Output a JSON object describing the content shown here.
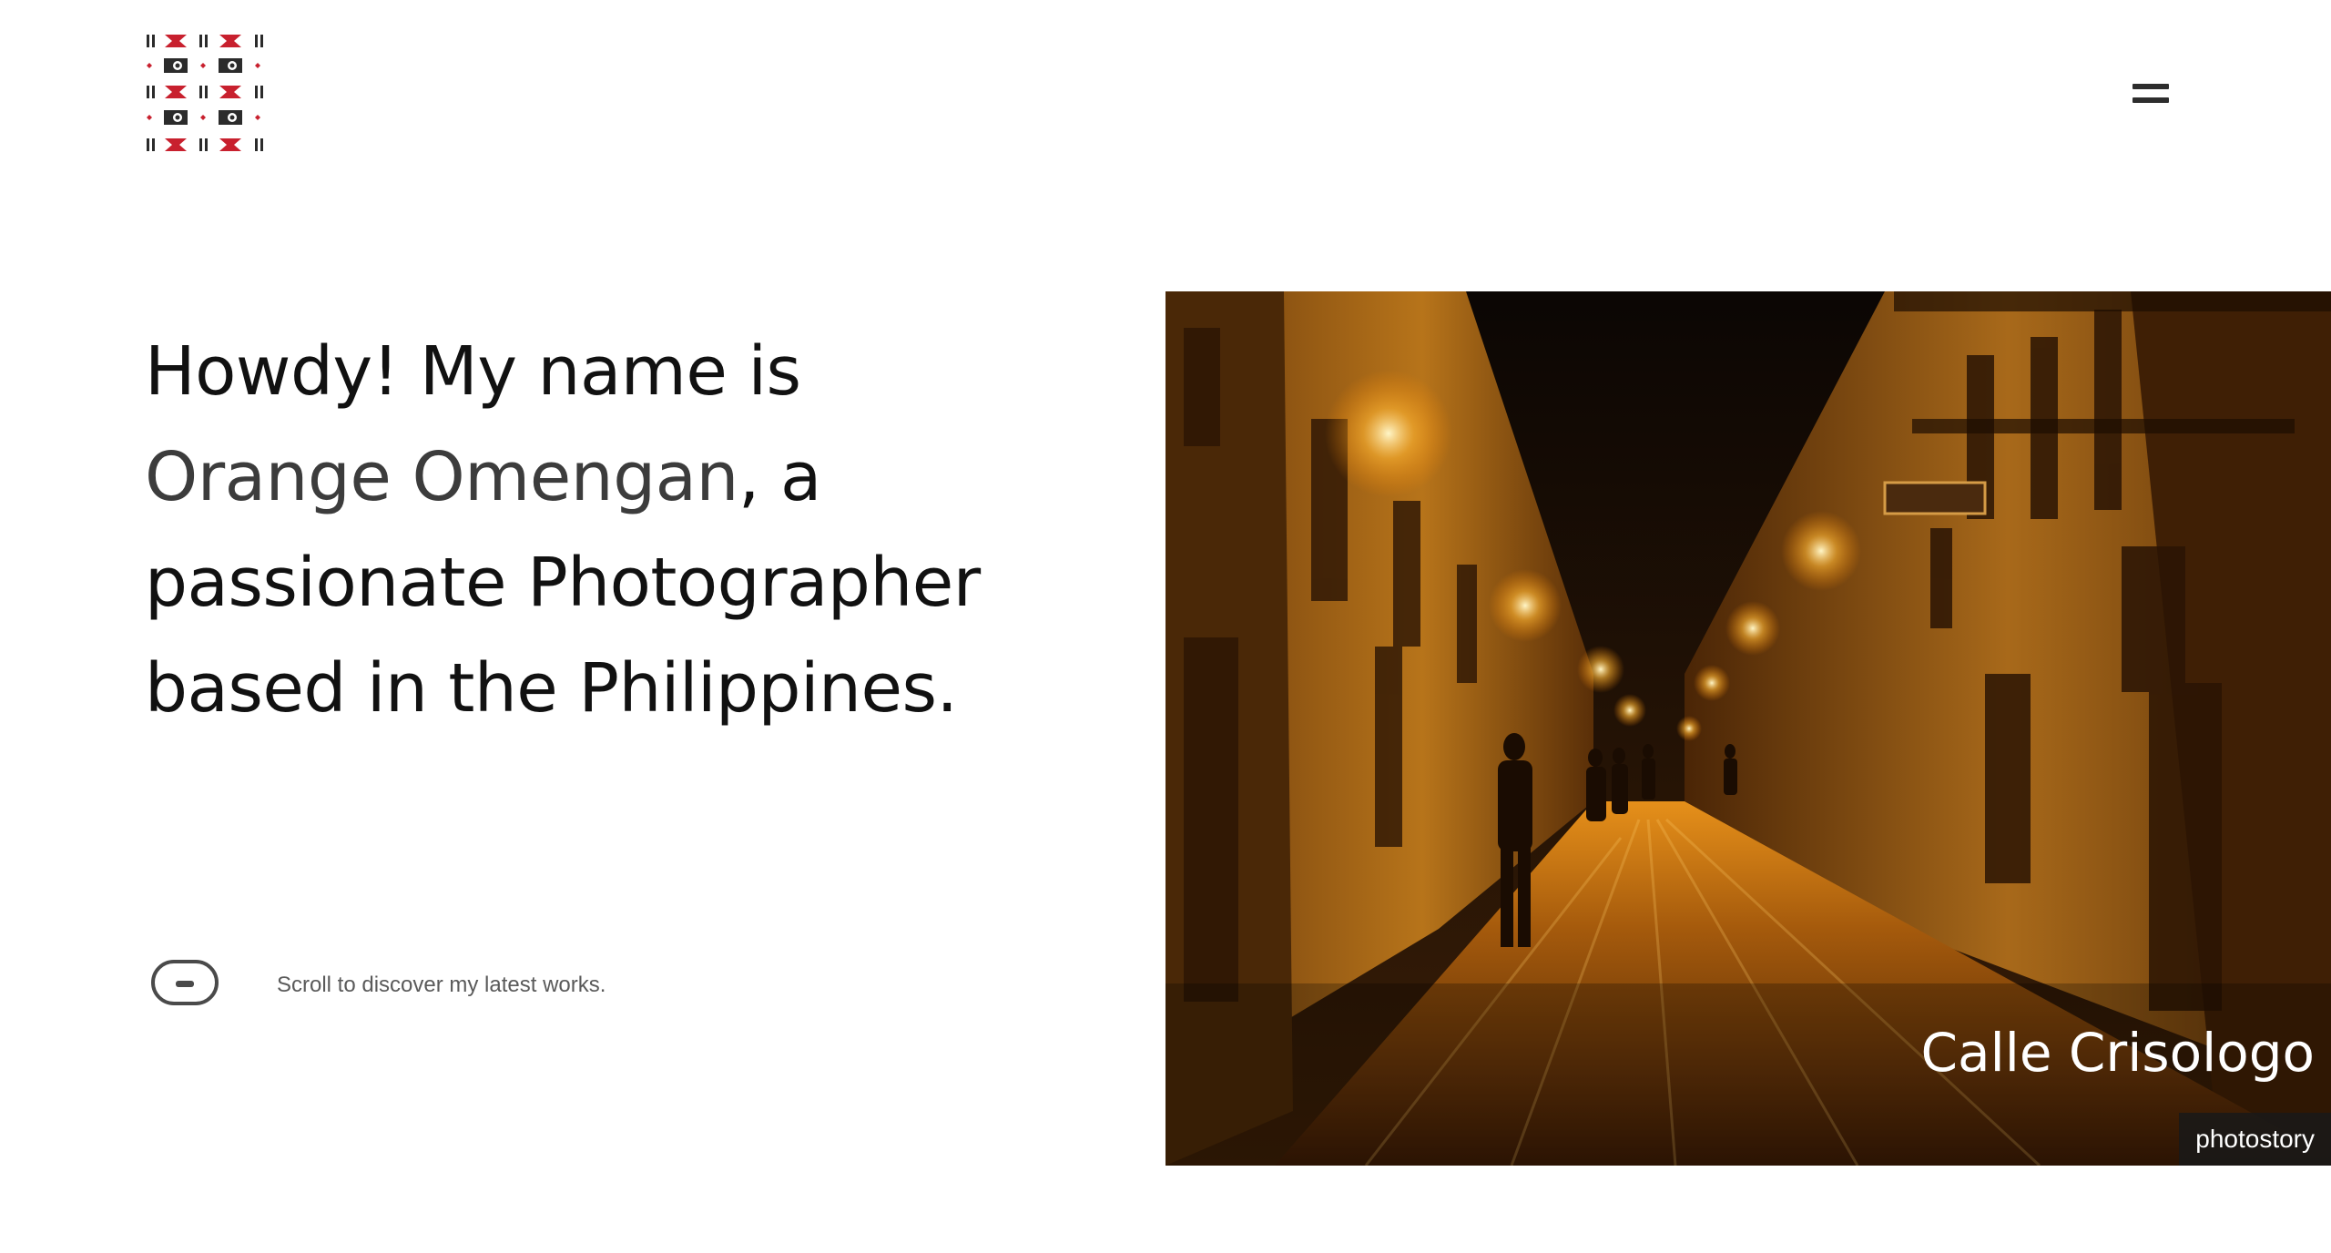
{
  "logo": {
    "name": "camera-pattern-logo"
  },
  "menu": {
    "icon": "hamburger-icon"
  },
  "intro": {
    "line1": "Howdy! My name is",
    "name": "Orange Omengan",
    "after_name": ", a",
    "line3": "passionate Photographer",
    "line4": "based in the Philippines."
  },
  "scroll_hint": {
    "icon": "mouse-scroll-icon",
    "text": "Scroll to discover my latest works."
  },
  "featured": {
    "title": "Calle Crisologo",
    "tag": "photostory"
  },
  "colors": {
    "logo_red": "#c8202e",
    "logo_dark": "#2b2b2b",
    "text": "#111111",
    "name": "#3c3c3c"
  }
}
